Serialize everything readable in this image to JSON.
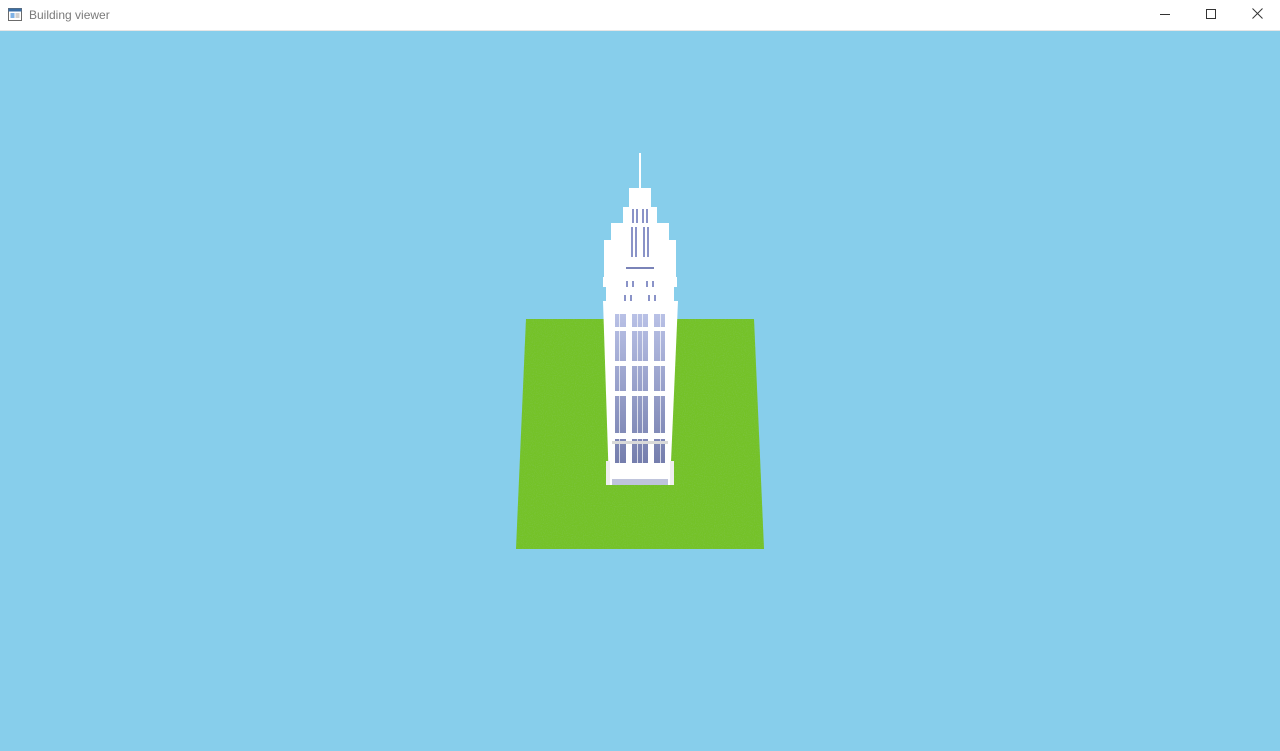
{
  "window": {
    "title": "Building viewer",
    "icons": {
      "app": "app-window-icon",
      "minimize": "minimize-icon",
      "maximize": "maximize-icon",
      "close": "close-icon"
    }
  },
  "scene": {
    "sky_color": "#87CEEB",
    "ground_color": "#7CCB2E",
    "building_color": "#FFFFFF",
    "window_color": "#8A93C8"
  }
}
